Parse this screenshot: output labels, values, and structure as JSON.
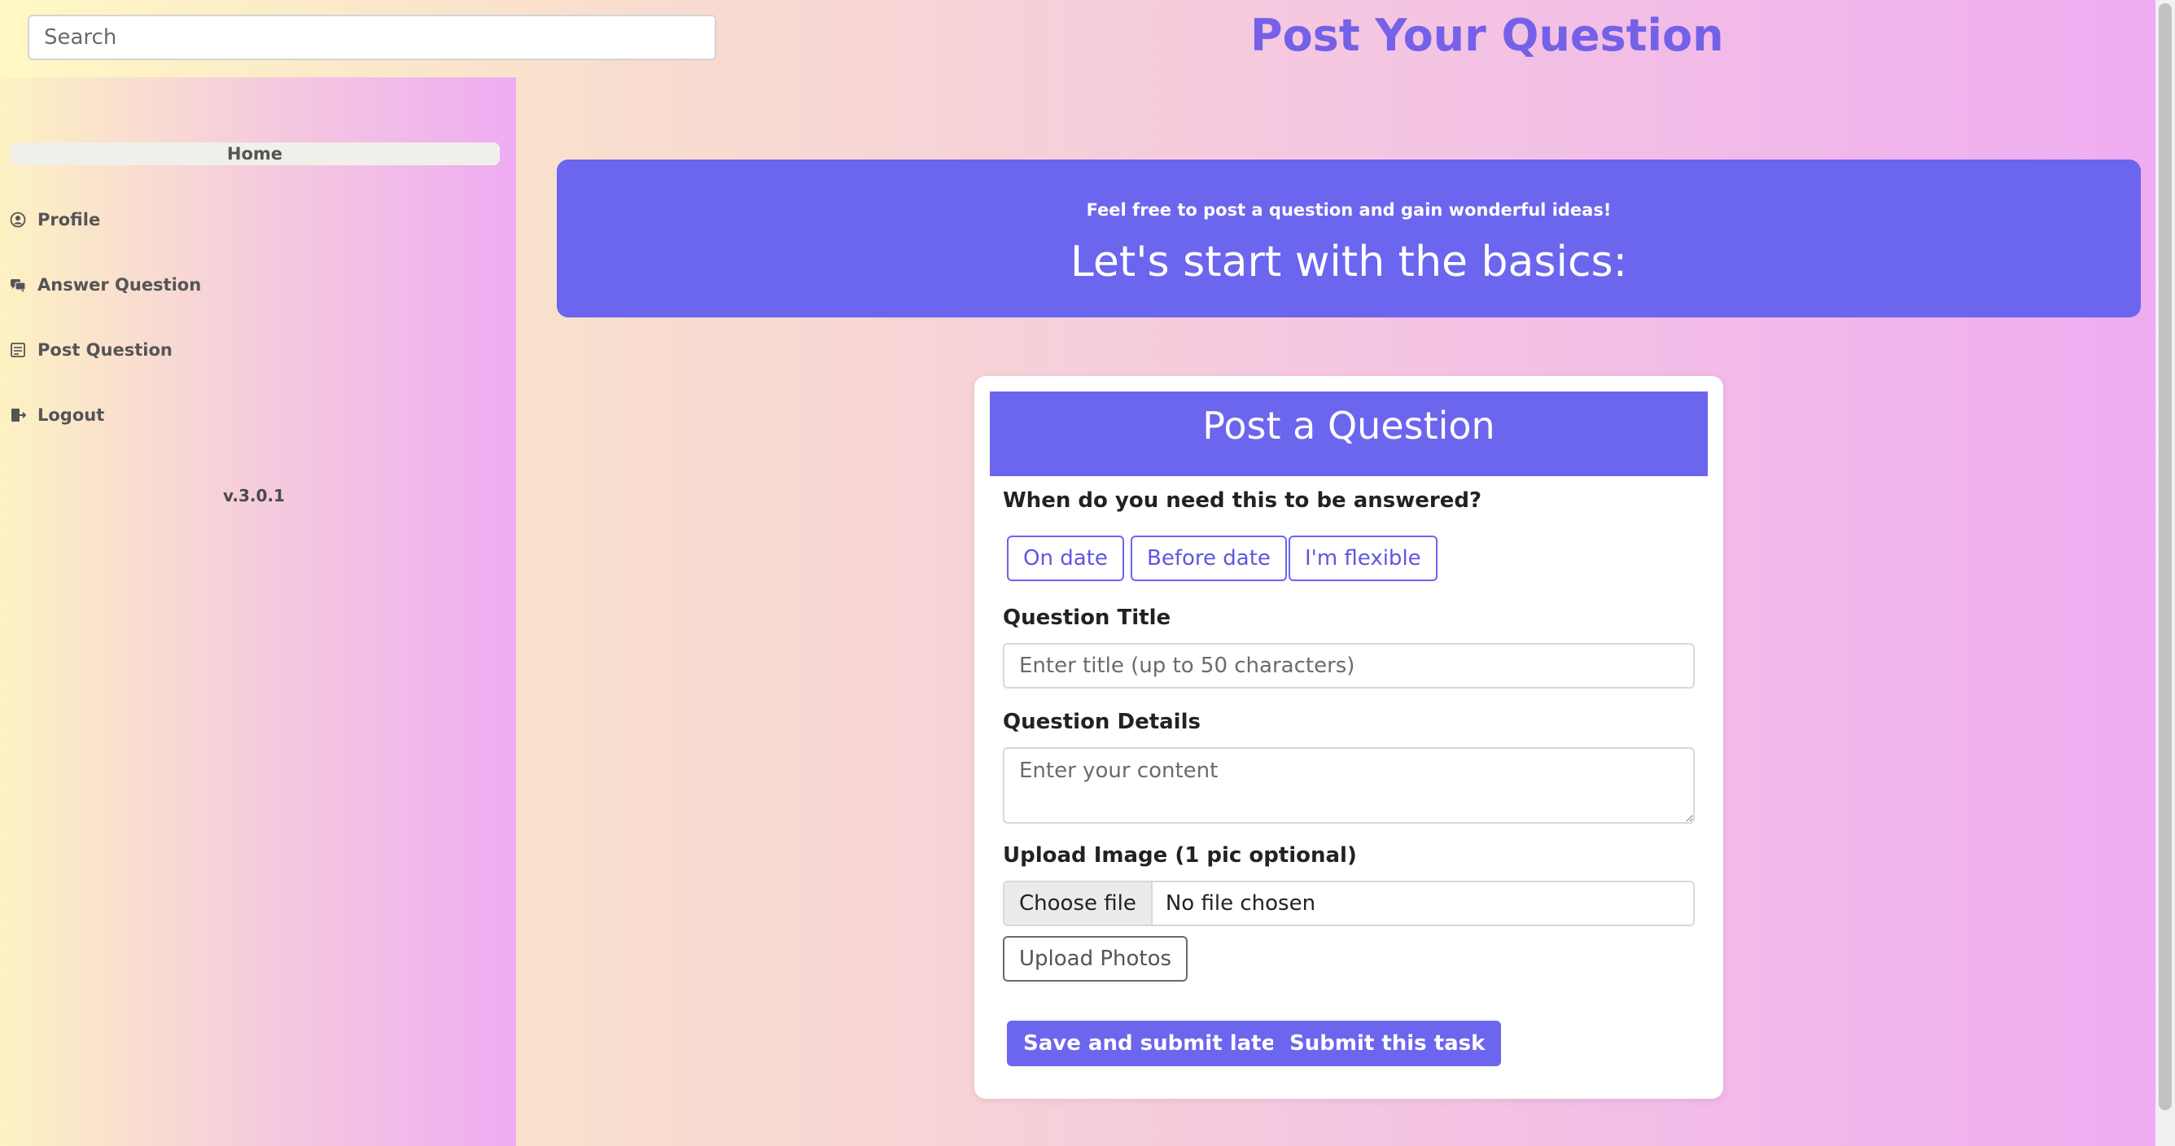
{
  "search": {
    "placeholder": "Search"
  },
  "header": {
    "title": "Post Your Question"
  },
  "sidebar": {
    "home_label": "Home",
    "items": [
      {
        "label": "Profile",
        "icon": "user-icon"
      },
      {
        "label": "Answer Question",
        "icon": "comments-icon"
      },
      {
        "label": "Post Question",
        "icon": "document-icon"
      },
      {
        "label": "Logout",
        "icon": "logout-icon"
      }
    ],
    "version": "v.3.0.1"
  },
  "banner": {
    "subtitle": "Feel free to post a question and gain wonderful ideas!",
    "title": "Let's start with the basics:"
  },
  "form": {
    "header": "Post a Question",
    "when_label": "When do you need this to be answered?",
    "when_options": [
      "On date",
      "Before date",
      "I'm flexible"
    ],
    "title_label": "Question Title",
    "title_placeholder": "Enter title (up to 50 characters)",
    "details_label": "Question Details",
    "details_placeholder": "Enter your content",
    "upload_label": "Upload Image (1 pic optional)",
    "choose_file": "Choose file",
    "no_file": "No file chosen",
    "upload_photos": "Upload Photos",
    "save_later": "Save and submit later",
    "submit": "Submit this task"
  },
  "colors": {
    "accent": "#6c65ee",
    "title": "#7461e8"
  }
}
